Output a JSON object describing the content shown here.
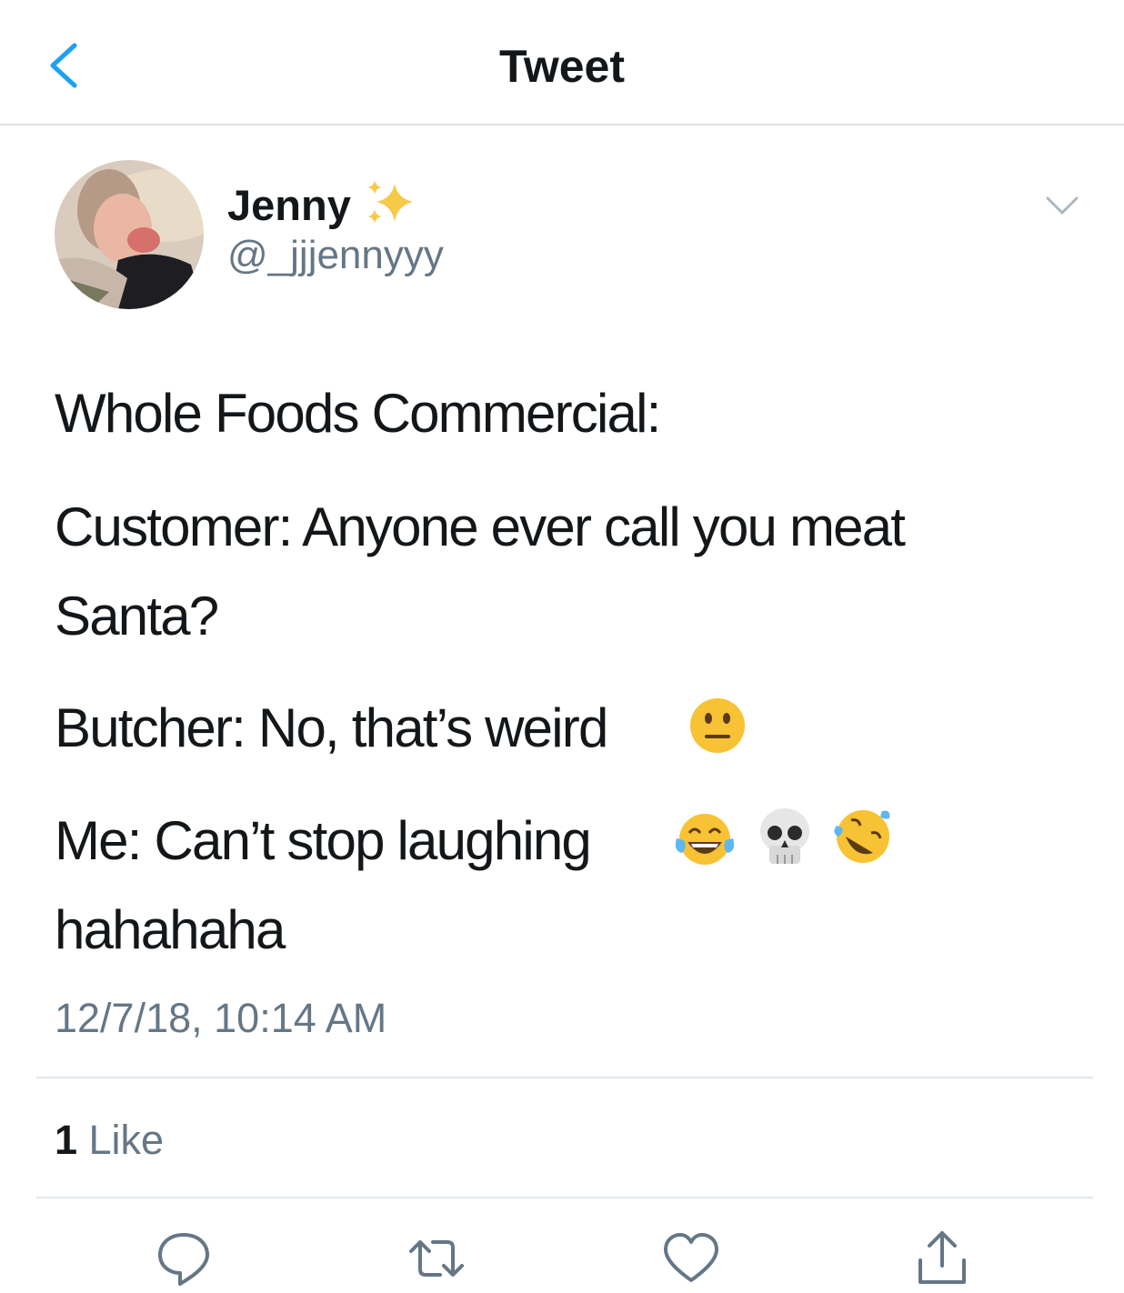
{
  "header": {
    "title": "Tweet",
    "back_icon": "chevron-left-icon",
    "accent_color": "#1da1f2"
  },
  "tweet": {
    "author": {
      "name": "Jenny",
      "name_emoji": "sparkles-icon",
      "handle": "@_jjjennyyy"
    },
    "lines": [
      "Whole Foods Commercial:",
      "Customer: Anyone ever call you meat",
      "Santa?",
      "Butcher: No, that’s weird",
      "Me: Can’t stop laughing",
      "hahahaha"
    ],
    "emojis": [
      "neutral-face-icon",
      "face-with-tears-of-joy-icon",
      "skull-icon",
      "rolling-on-floor-laughing-icon"
    ],
    "timestamp": "12/7/18, 10:14 AM"
  },
  "stats": {
    "likes_count": "1",
    "likes_label": " Like"
  },
  "actions": [
    "reply-icon",
    "retweet-icon",
    "like-icon",
    "share-icon"
  ]
}
